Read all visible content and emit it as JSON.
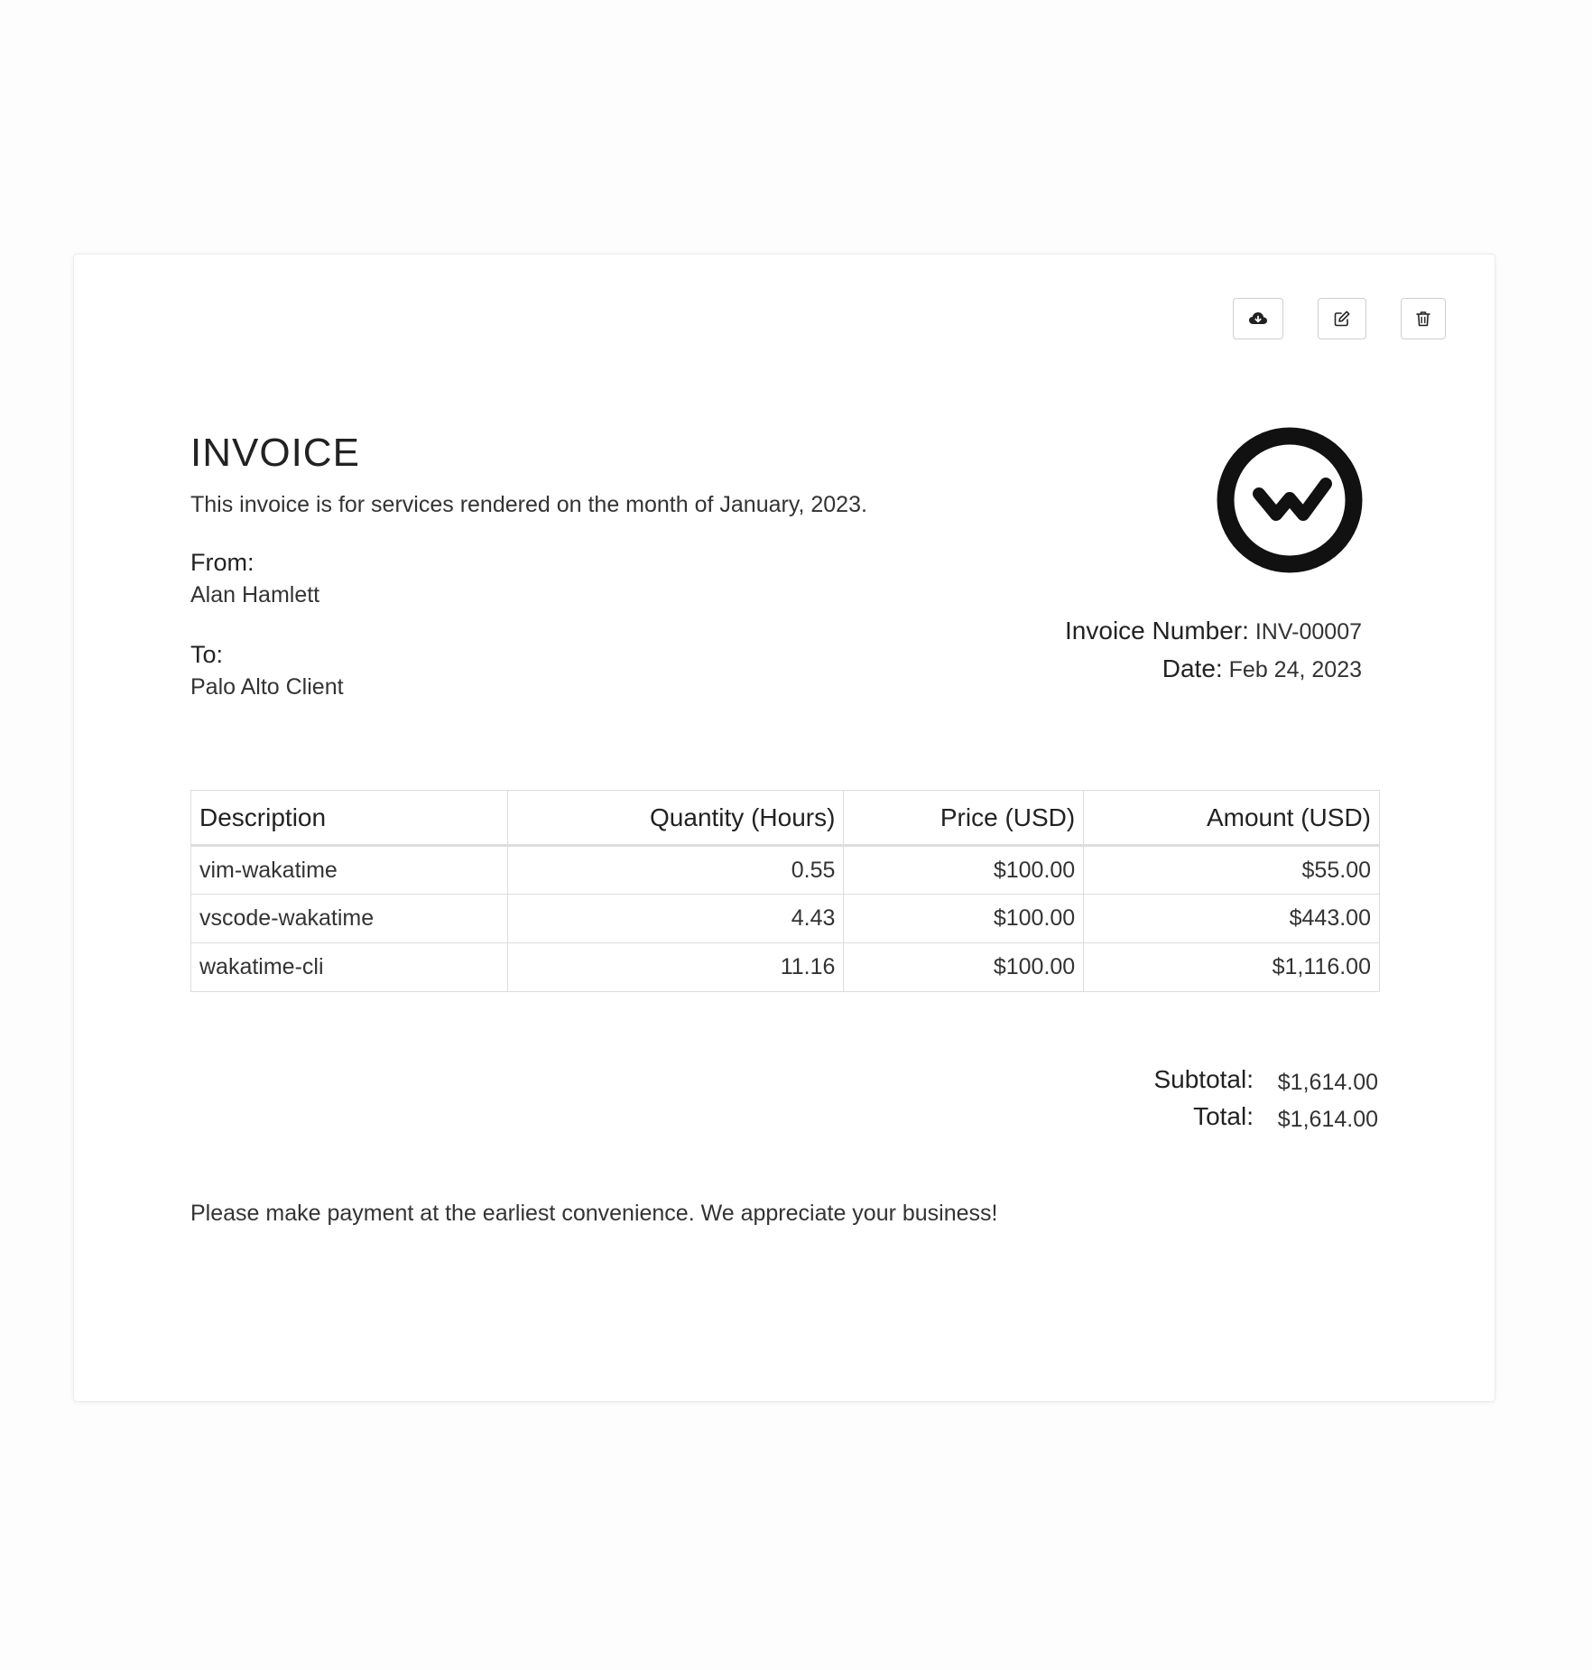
{
  "toolbar": {
    "download_icon": "cloud-download-icon",
    "edit_icon": "edit-icon",
    "delete_icon": "trash-icon"
  },
  "invoice": {
    "title": "INVOICE",
    "subtitle": "This invoice is for services rendered on the month of January, 2023.",
    "from_label": "From:",
    "from_name": "Alan Hamlett",
    "to_label": "To:",
    "to_name": "Palo Alto Client",
    "logo_icon": "wakatime-logo-icon",
    "number_label": "Invoice Number:",
    "number_value": "INV-00007",
    "date_label": "Date:",
    "date_value": "Feb 24, 2023"
  },
  "table": {
    "headers": [
      "Description",
      "Quantity (Hours)",
      "Price (USD)",
      "Amount (USD)"
    ],
    "rows": [
      [
        "vim-wakatime",
        "0.55",
        "$100.00",
        "$55.00"
      ],
      [
        "vscode-wakatime",
        "4.43",
        "$100.00",
        "$443.00"
      ],
      [
        "wakatime-cli",
        "11.16",
        "$100.00",
        "$1,116.00"
      ]
    ]
  },
  "totals": {
    "subtotal_label": "Subtotal:",
    "subtotal_value": "$1,614.00",
    "total_label": "Total:",
    "total_value": "$1,614.00"
  },
  "footer": {
    "note": "Please make payment at the earliest convenience. We appreciate your business!"
  },
  "colors": {
    "text": "#222222",
    "border": "#dddddd",
    "background": "#fdfdfd"
  }
}
